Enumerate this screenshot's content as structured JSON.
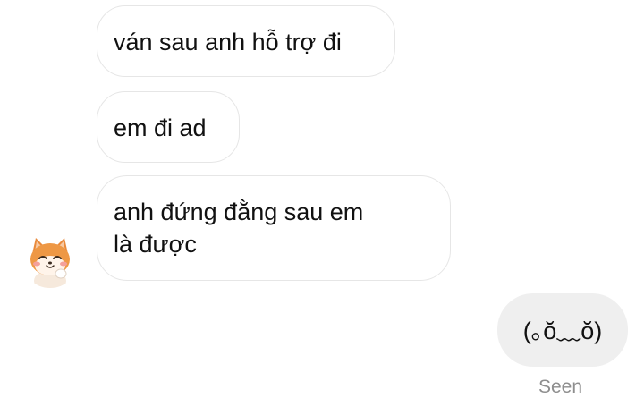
{
  "messages": [
    {
      "direction": "incoming",
      "text": "ván sau anh hỗ trợ đi"
    },
    {
      "direction": "incoming",
      "text": "em đi ad"
    },
    {
      "direction": "incoming",
      "text": "anh đứng đằng sau em\nlà được"
    },
    {
      "direction": "outgoing",
      "text": "(｡ŏ﹏ŏ)"
    }
  ],
  "status": {
    "seen_label": "Seen"
  },
  "avatar": {
    "icon": "shiba-dog-avatar-icon"
  },
  "colors": {
    "incoming_bubble_bg": "#ffffff",
    "incoming_bubble_border": "#e6e6e6",
    "outgoing_bubble_bg": "#efefef",
    "text": "#111111",
    "seen_text": "#8e8e8e"
  }
}
